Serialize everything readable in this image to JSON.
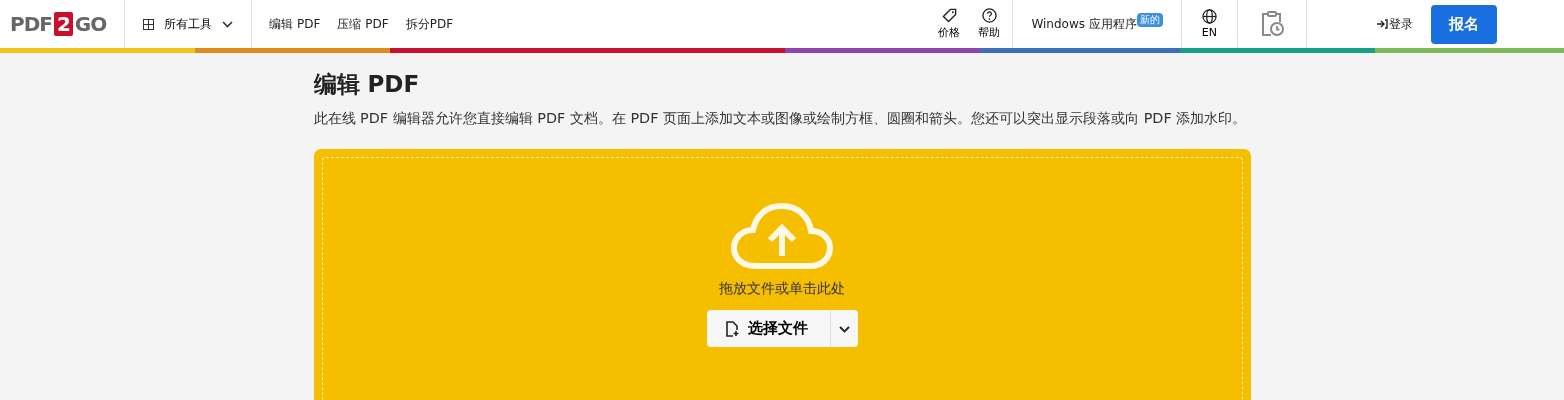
{
  "logo": {
    "left": "PDF",
    "middle": "2",
    "right": "GO"
  },
  "nav": {
    "all_tools": "所有工具",
    "links": [
      "编辑 PDF",
      "压缩 PDF",
      "拆分PDF"
    ]
  },
  "header_right": {
    "pricing": "价格",
    "help": "帮助",
    "windows_app": "Windows 应用程序",
    "new_badge": "新的",
    "language": "EN",
    "login": "登录",
    "signup": "报名"
  },
  "page": {
    "title": "编辑 PDF",
    "description": "此在线 PDF 编辑器允许您直接编辑 PDF 文档。在 PDF 页面上添加文本或图像或绘制方框、圆圈和箭头。您还可以突出显示段落或向 PDF 添加水印。"
  },
  "upload": {
    "hint": "拖放文件或单击此处",
    "button": "选择文件"
  }
}
